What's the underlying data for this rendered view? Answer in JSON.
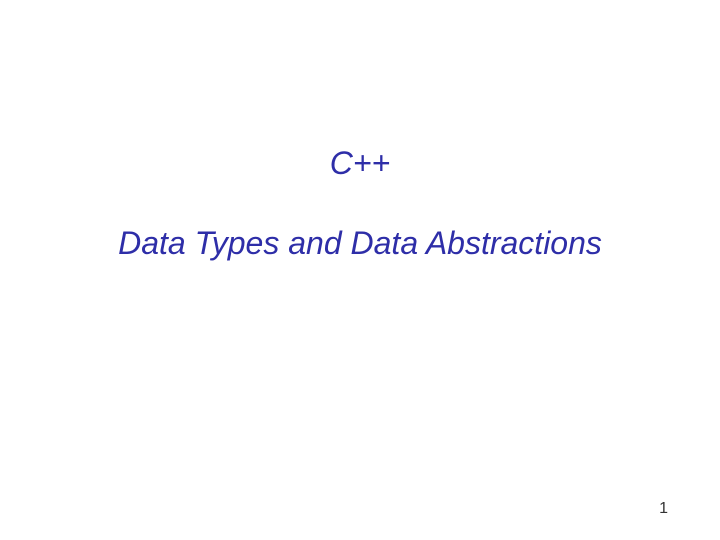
{
  "slide": {
    "title": "C++",
    "subtitle": "Data Types and Data Abstractions",
    "page_number": "1"
  }
}
